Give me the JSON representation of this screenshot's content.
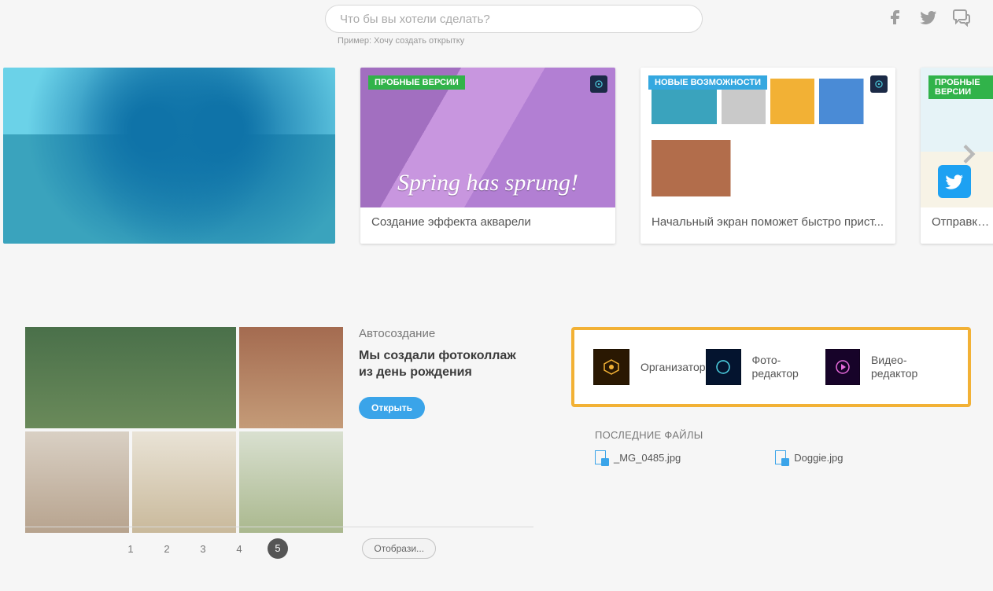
{
  "search": {
    "placeholder": "Что бы вы хотели сделать?",
    "example": "Пример: Хочу создать открытку"
  },
  "badges": {
    "trial": "ПРОБНЫЕ ВЕРСИИ",
    "new": "НОВЫЕ ВОЗМОЖНОСТИ"
  },
  "cards": {
    "watercolor": {
      "overlay": "Spring has sprung!",
      "caption": "Создание эффекта акварели"
    },
    "homescreen": {
      "caption": "Начальный экран поможет быстро прист..."
    },
    "share": {
      "caption": "Отправка фо"
    }
  },
  "autocreate": {
    "label": "Автосоздание",
    "title": "Мы создали фотоколлаж из день рождения",
    "open": "Открыть",
    "show": "Отобрази...",
    "pages": [
      "1",
      "2",
      "3",
      "4",
      "5"
    ],
    "current_page": "5"
  },
  "editors": {
    "organizer": "Организатор",
    "photo": "Фото-редактор",
    "video": "Видео-редактор"
  },
  "recent": {
    "title": "ПОСЛЕДНИЕ ФАЙЛЫ",
    "files": [
      "_MG_0485.jpg",
      "Doggie.jpg"
    ]
  }
}
